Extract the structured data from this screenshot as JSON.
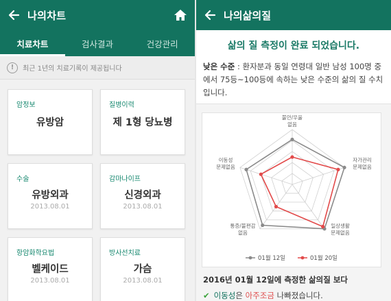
{
  "colors": {
    "brand": "#13735f",
    "series1": "#8a8a8a",
    "series2": "#e24a4a",
    "check": "#3aa33a"
  },
  "left": {
    "title": "나의차트",
    "tabs": [
      {
        "label": "치료차트",
        "active": true
      },
      {
        "label": "검사결과",
        "active": false
      },
      {
        "label": "건강관리",
        "active": false
      }
    ],
    "notice": "최근 1년의 치료기록이 제공됩니다",
    "cards": [
      {
        "label": "암정보",
        "value": "유방암",
        "date": ""
      },
      {
        "label": "질병이력",
        "value": "제 1형 당뇨병",
        "date": ""
      },
      {
        "label": "수술",
        "value": "유방외과",
        "date": "2013.08.01"
      },
      {
        "label": "감마나이프",
        "value": "신경외과",
        "date": "2013.08.01"
      },
      {
        "label": "항암화학요법",
        "value": "벨케이드",
        "date": "2013.08.01"
      },
      {
        "label": "방사선치료",
        "value": "가슴",
        "date": "2013.08.01"
      }
    ]
  },
  "right": {
    "title": "나의삶의질",
    "headline": "삶의 질 측정이 완료 되었습니다.",
    "level_label": "낮은 수준",
    "level_desc": " : 환자분과 동일 연령대 일반 남성 100명 중에서 75등~100등에 속하는 낮은 수준의 삶의 질 수치입니다.",
    "chart_data": {
      "type": "radar",
      "axes": [
        "불안/우울 없음",
        "자가관리 문제없음",
        "일상생활 문제없음",
        "통증/불편감 없음",
        "이동성 문제없음"
      ],
      "series": [
        {
          "name": "01월 12일",
          "values": [
            0.82,
            1.0,
            1.0,
            0.92,
            0.88
          ]
        },
        {
          "name": "01월 20일",
          "values": [
            0.5,
            0.88,
            0.95,
            0.5,
            0.6
          ]
        }
      ]
    },
    "axis_labels": [
      [
        "불안/우울",
        "없음"
      ],
      [
        "자가관리",
        "문제없음"
      ],
      [
        "일상생활",
        "문제없음"
      ],
      [
        "통증/불편감",
        "없음"
      ],
      [
        "이동성",
        "문제없음"
      ]
    ],
    "compare_title": "2016년 01월 12일에 측정한 삶의질 보다",
    "compare_item": "이동성",
    "compare_mid": "은 ",
    "compare_change": "아주조금",
    "compare_tail": " 나빠졌습니다."
  }
}
